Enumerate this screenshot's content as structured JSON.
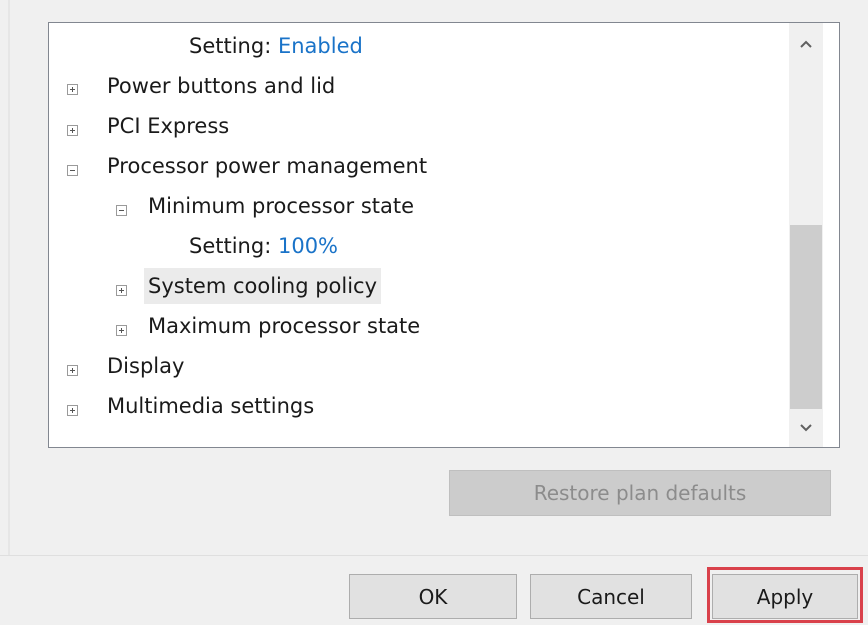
{
  "tree": {
    "rows": [
      {
        "label": "Setting:",
        "value": "Enabled"
      },
      {
        "label": "Power buttons and lid"
      },
      {
        "label": "PCI Express"
      },
      {
        "label": "Processor power management"
      },
      {
        "label": "Minimum processor state"
      },
      {
        "label": "Setting:",
        "value": "100%"
      },
      {
        "label": "System cooling policy"
      },
      {
        "label": "Maximum processor state"
      },
      {
        "label": "Display"
      },
      {
        "label": "Multimedia settings"
      }
    ]
  },
  "buttons": {
    "restore": "Restore plan defaults",
    "ok": "OK",
    "cancel": "Cancel",
    "apply": "Apply"
  },
  "colors": {
    "link_value": "#1a73c8",
    "highlight_border": "#d9414b"
  }
}
